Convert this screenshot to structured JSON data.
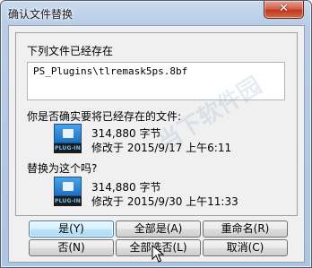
{
  "window": {
    "title": "确认文件替换",
    "close_glyph": "✕"
  },
  "existing_label": "下列文件已经存在",
  "filename": "PS_Plugins\\tlremask5ps.8bf",
  "question": "你是否确实要将已经存在的文件:",
  "existing_file": {
    "icon_label": "PLUG-IN",
    "size": "314,880 字节",
    "modified": "修改于 2015/9/17 上午6:11"
  },
  "replace_label": "替换为这个吗?",
  "new_file": {
    "icon_label": "PLUG-IN",
    "size": "314,880 字节",
    "modified": "修改于 2015/9/30 上午11:33"
  },
  "buttons": {
    "yes": "是(Y)",
    "yes_all": "全部是(A)",
    "rename": "重命名(R)",
    "no": "否(N)",
    "no_all": "全部选否(L)",
    "cancel": "取消(C)"
  },
  "watermark": "当下软件园"
}
